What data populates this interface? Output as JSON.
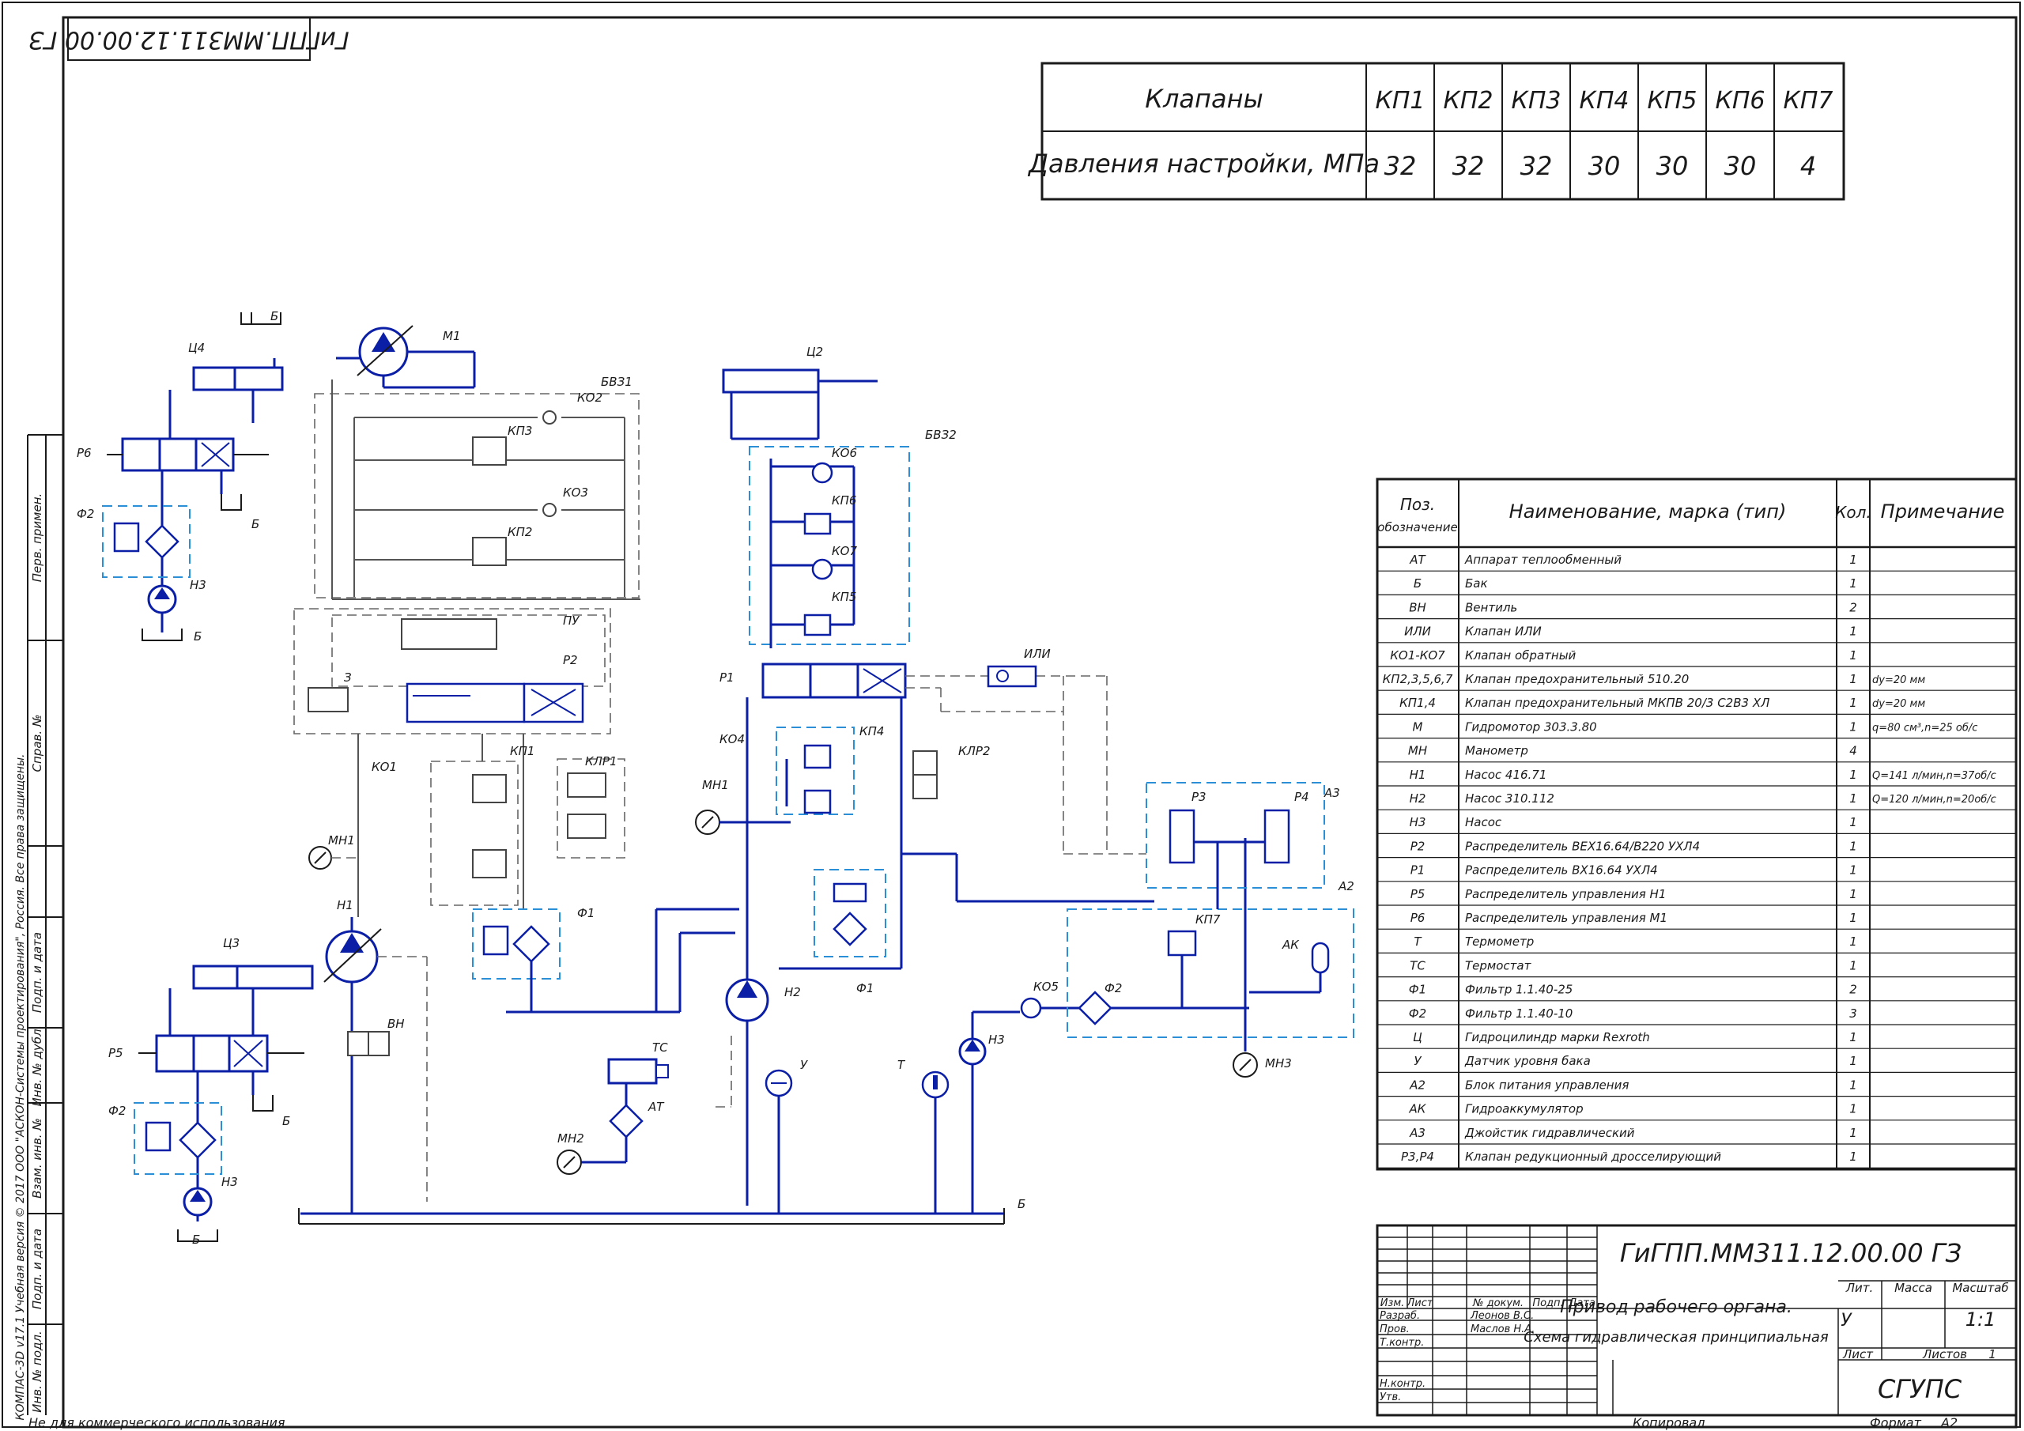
{
  "stamp_rotated": "ГиГПП.ММ311.12.00.00 ГЗ",
  "settings_table": {
    "row1_label": "Клапаны",
    "row2_label": "Давления настройки, МПа",
    "valves": [
      "КП1",
      "КП2",
      "КП3",
      "КП4",
      "КП5",
      "КП6",
      "КП7"
    ],
    "pressures": [
      "32",
      "32",
      "32",
      "30",
      "30",
      "30",
      "4"
    ]
  },
  "diagram_labels": [
    "Б",
    "М1",
    "Ц4",
    "Р6",
    "Б",
    "Ф2",
    "Н3",
    "Б",
    "БВЗ1",
    "КО2",
    "КП3",
    "КО3",
    "КП2",
    "ПУ",
    "З",
    "Р2",
    "КО1",
    "КП1",
    "КЛР1",
    "МН1",
    "Н1",
    "Ц3",
    "ВН",
    "Р5",
    "Ф2",
    "Б",
    "Н3",
    "Б",
    "Ф1",
    "ТС",
    "АТ",
    "МН2",
    "Ц2",
    "БВЗ2",
    "КО6",
    "КП6",
    "КО7",
    "КП5",
    "Р1",
    "ИЛИ",
    "КО4",
    "МН1",
    "КП4",
    "КЛР2",
    "Ф1",
    "Н2",
    "У",
    "Т",
    "КО5",
    "Ф2",
    "Н3",
    "Р3",
    "Р4",
    "А3",
    "А2",
    "КП7",
    "АК",
    "МН3",
    "Б"
  ],
  "spec_table": {
    "headers": {
      "pos_line1": "Поз.",
      "pos_line2": "обозначение",
      "name": "Наименование, марка (тип)",
      "qty": "Кол.",
      "note": "Примечание"
    },
    "rows": [
      {
        "pos": "АТ",
        "name": "Аппарат теплообменный",
        "qty": "1",
        "note": ""
      },
      {
        "pos": "Б",
        "name": "Бак",
        "qty": "1",
        "note": ""
      },
      {
        "pos": "ВН",
        "name": "Вентиль",
        "qty": "2",
        "note": ""
      },
      {
        "pos": "ИЛИ",
        "name": "Клапан ИЛИ",
        "qty": "1",
        "note": ""
      },
      {
        "pos": "КО1-КО7",
        "name": "Клапан обратный",
        "qty": "1",
        "note": ""
      },
      {
        "pos": "КП2,3,5,6,7",
        "name": "Клапан предохранительный 510.20",
        "qty": "1",
        "note": "dу=20 мм"
      },
      {
        "pos": "КП1,4",
        "name": "Клапан предохранительный МКПВ 20/3 С2В3 ХЛ",
        "qty": "1",
        "note": "dу=20 мм"
      },
      {
        "pos": "М",
        "name": "Гидромотор 303.3.80",
        "qty": "1",
        "note": "q=80 см³,n=25 об/с"
      },
      {
        "pos": "МН",
        "name": "Манометр",
        "qty": "4",
        "note": ""
      },
      {
        "pos": "Н1",
        "name": "Насос 416.71",
        "qty": "1",
        "note": "Q=141 л/мин,n=37об/с"
      },
      {
        "pos": "Н2",
        "name": "Насос 310.112",
        "qty": "1",
        "note": "Q=120 л/мин,n=20об/с"
      },
      {
        "pos": "Н3",
        "name": "Насос",
        "qty": "1",
        "note": ""
      },
      {
        "pos": "Р2",
        "name": "Распределитель ВЕХ16.64/В220 УХЛ4",
        "qty": "1",
        "note": ""
      },
      {
        "pos": "Р1",
        "name": "Распределитель ВХ16.64 УХЛ4",
        "qty": "1",
        "note": ""
      },
      {
        "pos": "Р5",
        "name": "Распределитель управления Н1",
        "qty": "1",
        "note": ""
      },
      {
        "pos": "Р6",
        "name": "Распределитель управления М1",
        "qty": "1",
        "note": ""
      },
      {
        "pos": "Т",
        "name": "Термометр",
        "qty": "1",
        "note": ""
      },
      {
        "pos": "ТС",
        "name": "Термостат",
        "qty": "1",
        "note": ""
      },
      {
        "pos": "Ф1",
        "name": "Фильтр 1.1.40-25",
        "qty": "2",
        "note": ""
      },
      {
        "pos": "Ф2",
        "name": "Фильтр 1.1.40-10",
        "qty": "3",
        "note": ""
      },
      {
        "pos": "Ц",
        "name": "Гидроцилиндр марки Rexroth",
        "qty": "1",
        "note": ""
      },
      {
        "pos": "У",
        "name": "Датчик уровня бака",
        "qty": "1",
        "note": ""
      },
      {
        "pos": "А2",
        "name": "Блок питания управления",
        "qty": "1",
        "note": ""
      },
      {
        "pos": "АК",
        "name": "Гидроаккумулятор",
        "qty": "1",
        "note": ""
      },
      {
        "pos": "А3",
        "name": "Джойстик гидравлический",
        "qty": "1",
        "note": ""
      },
      {
        "pos": "Р3,Р4",
        "name": "Клапан редукционный дросселирующий",
        "qty": "1",
        "note": ""
      }
    ]
  },
  "title_block": {
    "doc_number": "ГиГПП.ММ311.12.00.00 ГЗ",
    "title_line1": "Привод рабочего органа.",
    "title_line2": "Схема гидравлическая принципиальная",
    "col_heads": [
      "Изм.",
      "Лист",
      "№ докум.",
      "Подп.",
      "Дата"
    ],
    "roles": [
      "Разраб.",
      "Пров.",
      "Т.контр.",
      "",
      "Н.контр.",
      "Утв."
    ],
    "names": [
      "Леонов В.С.",
      "Маслов Н.А.",
      "",
      "",
      "",
      ""
    ],
    "lit_label": "Лит.",
    "mass_label": "Масса",
    "scale_label": "Масштаб",
    "lit_value": "У",
    "scale_value": "1:1",
    "sheet_label": "Лист",
    "sheets_label": "Листов",
    "sheets_value": "1",
    "org": "СГУПС"
  },
  "side_strip": {
    "labels": [
      "Перв. примен.",
      "Справ. №",
      "Подп. и дата",
      "Инв. № дубл.",
      "Взам. инв. №",
      "Подп. и дата",
      "Инв. № подл."
    ],
    "copyright": "КОМПАС-3D v17.1 Учебная версия © 2017 ООО \"АСКОН-Системы проектирования\", Россия. Все права защищены."
  },
  "footer": {
    "noncommercial": "Не для коммерческого использования",
    "copied": "Копировал",
    "format_label": "Формат",
    "format_value": "А2"
  }
}
